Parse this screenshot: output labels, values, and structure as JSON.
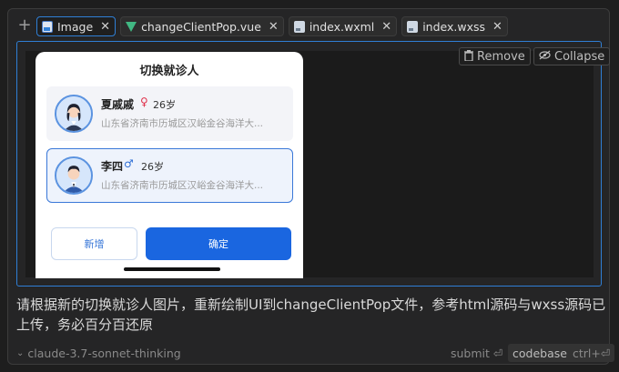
{
  "tabs": [
    {
      "label": "Image",
      "icon": "image-icon",
      "active": true
    },
    {
      "label": "changeClientPop.vue",
      "icon": "vue-icon",
      "active": false
    },
    {
      "label": "index.wxml",
      "icon": "file-icon",
      "active": false
    },
    {
      "label": "index.wxss",
      "icon": "file-icon",
      "active": false
    }
  ],
  "add_label": "+",
  "close_glyph": "✕",
  "image_actions": {
    "remove": "Remove",
    "collapse": "Collapse"
  },
  "phone": {
    "title": "切换就诊人",
    "patients": [
      {
        "name": "夏戚戚",
        "gender": "female",
        "gender_symbol": "♀",
        "age": "26岁",
        "address": "山东省济南市历城区汉峪金谷海洋大...",
        "selected": false
      },
      {
        "name": "李四",
        "gender": "male",
        "gender_symbol": "♂",
        "age": "26岁",
        "address": "山东省济南市历城区汉峪金谷海洋大...",
        "selected": true
      }
    ],
    "btn_new": "新增",
    "btn_confirm": "确定"
  },
  "prompt": "请根据新的切换就诊人图片，重新绘制UI到changeClientPop文件，参考html源码与wxss源码已上传，务必百分百还原",
  "footer": {
    "model": "claude-3.7-sonnet-thinking",
    "submit": "submit ⏎",
    "codebase": "codebase",
    "codebase_shortcut": "ctrl+⏎"
  },
  "colors": {
    "accent": "#2f7fd6",
    "confirm": "#1a66e0",
    "female": "#e0304a",
    "male": "#2f6fd6"
  }
}
